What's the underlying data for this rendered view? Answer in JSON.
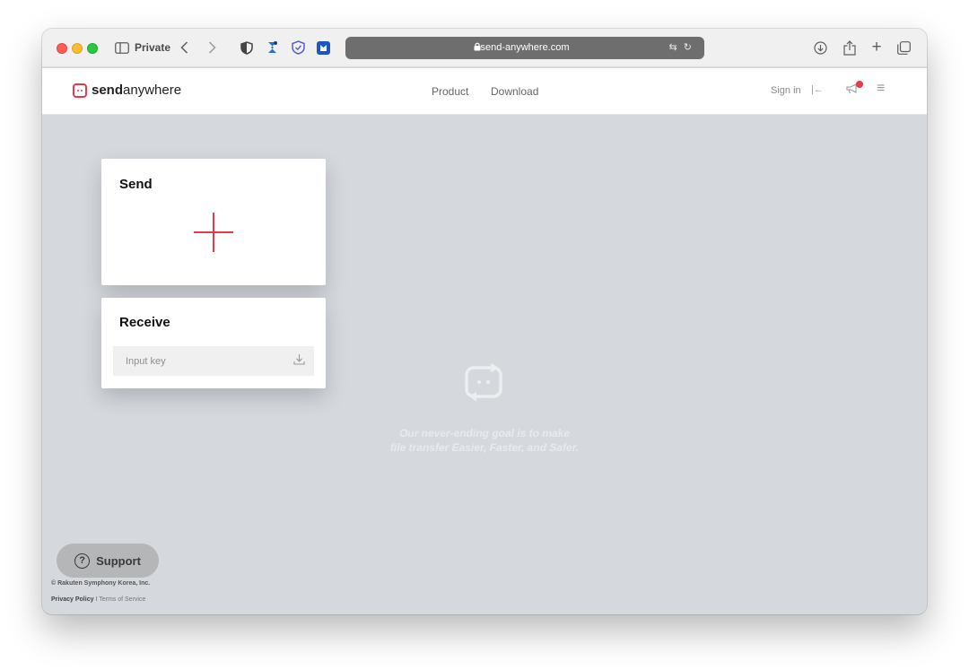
{
  "browser": {
    "private_label": "Private",
    "url": "send-anywhere.com",
    "icons": [
      "sidebar-icon",
      "back-icon",
      "forward-icon",
      "privacy-shield-icon",
      "extension-icon",
      "shield-check-icon",
      "extension-blue-icon",
      "lock-icon",
      "translate-icon",
      "reload-icon",
      "download-icon",
      "share-icon",
      "new-tab-icon",
      "tabs-overview-icon"
    ]
  },
  "header": {
    "logo_bold": "send",
    "logo_light": "anywhere",
    "nav": [
      "Product",
      "Download"
    ],
    "signin_label": "Sign in",
    "accent_color": "#e8394b"
  },
  "send_card": {
    "title": "Send"
  },
  "receive_card": {
    "title": "Receive",
    "input_placeholder": "Input key"
  },
  "slogan": {
    "line1": "Our never-ending goal is to make",
    "line2": "file transfer Easier, Faster, and Safer."
  },
  "footer": {
    "support_label": "Support",
    "copyright": "© Rakuten Symphony Korea, Inc.",
    "privacy_label": "Privacy Policy",
    "separator": "I",
    "terms_label": "Terms of Service"
  }
}
